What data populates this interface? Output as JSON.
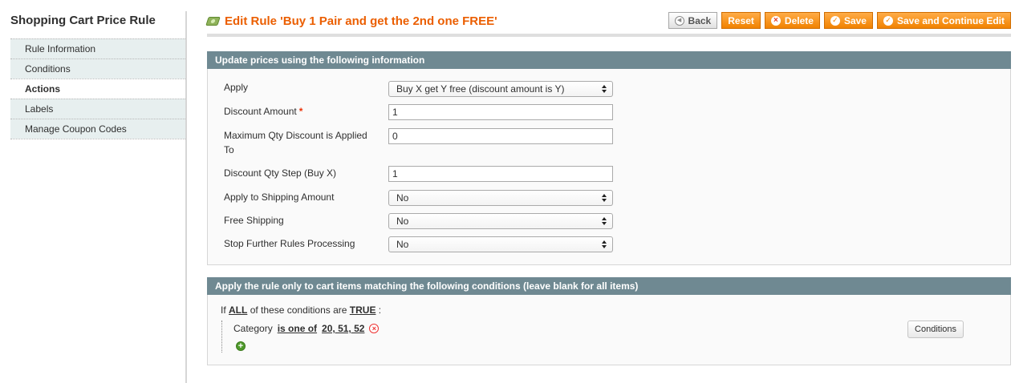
{
  "sidebar": {
    "title": "Shopping Cart Price Rule",
    "tabs": [
      {
        "label": "Rule Information"
      },
      {
        "label": "Conditions"
      },
      {
        "label": "Actions"
      },
      {
        "label": "Labels"
      },
      {
        "label": "Manage Coupon Codes"
      }
    ],
    "active_tab": "Actions"
  },
  "header": {
    "title": "Edit Rule 'Buy 1 Pair and get the 2nd one FREE'",
    "buttons": {
      "back": "Back",
      "reset": "Reset",
      "delete": "Delete",
      "save": "Save",
      "save_continue": "Save and Continue Edit"
    }
  },
  "actions_fieldset": {
    "legend": "Update prices using the following information",
    "fields": {
      "apply": {
        "label": "Apply",
        "value": "Buy X get Y free (discount amount is Y)"
      },
      "discount_amount": {
        "label": "Discount Amount",
        "required_mark": "*",
        "value": "1"
      },
      "max_qty": {
        "label": "Maximum Qty Discount is Applied To",
        "value": "0"
      },
      "qty_step": {
        "label": "Discount Qty Step (Buy X)",
        "value": "1"
      },
      "apply_shipping": {
        "label": "Apply to Shipping Amount",
        "value": "No"
      },
      "free_shipping": {
        "label": "Free Shipping",
        "value": "No"
      },
      "stop_rules": {
        "label": "Stop Further Rules Processing",
        "value": "No"
      }
    }
  },
  "conditions_fieldset": {
    "legend": "Apply the rule only to cart items matching the following conditions (leave blank for all items)",
    "if": "If",
    "aggregator": "ALL",
    "middle": "of these conditions are",
    "value": "TRUE",
    "colon": ":",
    "condition": {
      "attribute": "Category",
      "operator": "is one of",
      "value": "20, 51, 52"
    },
    "conditions_button": "Conditions"
  },
  "colors": {
    "accent": "#eb5e00",
    "button_orange": "#f18200",
    "fieldset_header": "#6f8992",
    "sidebar_tab": "#e7efef"
  }
}
